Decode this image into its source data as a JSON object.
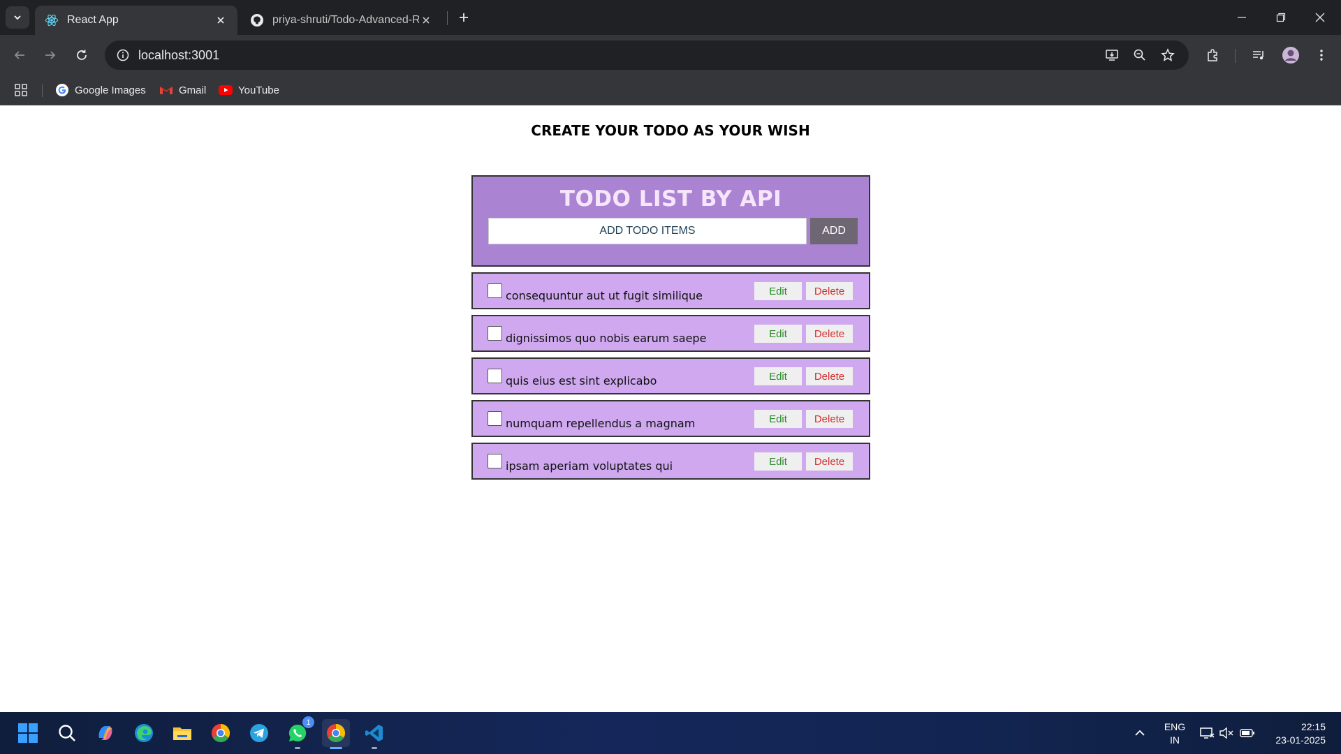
{
  "browser": {
    "tabs": [
      {
        "title": "React App",
        "active": true
      },
      {
        "title": "priya-shruti/Todo-Advanced-Re",
        "active": false
      }
    ],
    "url": "localhost:3001",
    "bookmarks": [
      {
        "label": "Google Images",
        "icon": "google-icon"
      },
      {
        "label": "Gmail",
        "icon": "gmail-icon"
      },
      {
        "label": "YouTube",
        "icon": "youtube-icon"
      }
    ]
  },
  "page": {
    "heading": "CREATE YOUR TODO AS YOUR WISH",
    "app_title": "TODO LIST BY API",
    "input_placeholder": "ADD TODO ITEMS",
    "add_label": "ADD",
    "edit_label": "Edit",
    "delete_label": "Delete",
    "todos": [
      {
        "text": "consequuntur aut ut fugit similique",
        "checked": false
      },
      {
        "text": "dignissimos quo nobis earum saepe",
        "checked": false
      },
      {
        "text": "quis eius est sint explicabo",
        "checked": false
      },
      {
        "text": "numquam repellendus a magnam",
        "checked": false
      },
      {
        "text": "ipsam aperiam voluptates qui",
        "checked": false
      }
    ]
  },
  "taskbar": {
    "whatsapp_badge": "1",
    "lang_line1": "ENG",
    "lang_line2": "IN",
    "time": "22:15",
    "date": "23-01-2025"
  },
  "colors": {
    "header_bg": "#ab83d3",
    "item_bg": "#cfa8f0",
    "edit_text": "#2c8a2c",
    "delete_text": "#d03030",
    "add_button_bg": "#6e6673"
  }
}
